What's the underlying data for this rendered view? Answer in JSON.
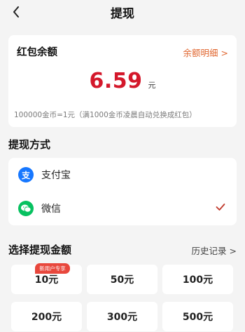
{
  "header": {
    "title": "提现"
  },
  "balance": {
    "title": "红包余额",
    "detail_link": "余额明细 >",
    "amount": "6.59",
    "unit": "元",
    "note": "100000金币=1元（满1000金币凌晨自动兑换成红包）"
  },
  "method_section": {
    "title": "提现方式",
    "methods": [
      {
        "label": "支付宝",
        "icon": "alipay-icon",
        "icon_glyph": "支",
        "color": "#1677ff",
        "selected": false
      },
      {
        "label": "微信",
        "icon": "wechat-icon",
        "icon_glyph": "",
        "color": "#07c160",
        "selected": true
      }
    ]
  },
  "amount_section": {
    "title": "选择提现金额",
    "history_link": "历史记录 >",
    "new_user_badge": "新用户专享",
    "options": [
      "10元",
      "50元",
      "100元",
      "200元",
      "300元",
      "500元"
    ]
  },
  "colors": {
    "accent_red": "#d4182b",
    "link_orange": "#e0662f",
    "check_red": "#c0392b"
  }
}
